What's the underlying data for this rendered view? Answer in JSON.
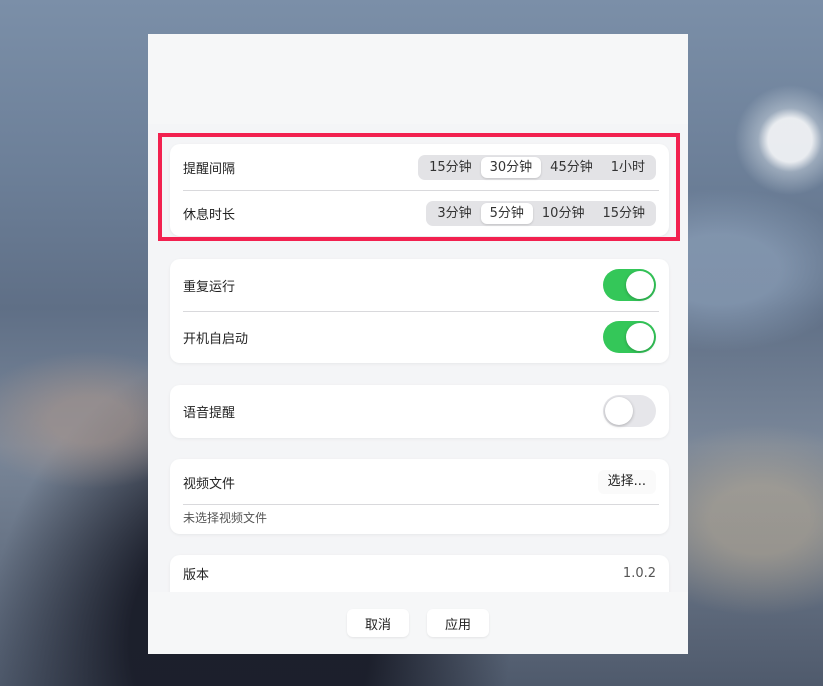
{
  "colors": {
    "accent": "#34c759",
    "highlight": "#f2214f"
  },
  "reminder": {
    "interval_label": "提醒间隔",
    "interval_options": [
      "15分钟",
      "30分钟",
      "45分钟",
      "1小时"
    ],
    "interval_selected": "30分钟",
    "rest_label": "休息时长",
    "rest_options": [
      "3分钟",
      "5分钟",
      "10分钟",
      "15分钟"
    ],
    "rest_selected": "5分钟"
  },
  "general": {
    "repeat_label": "重复运行",
    "repeat_on": true,
    "autostart_label": "开机自启动",
    "autostart_on": true
  },
  "voice": {
    "label": "语音提醒",
    "on": false
  },
  "video": {
    "label": "视频文件",
    "choose_label": "选择...",
    "status": "未选择视频文件"
  },
  "about": {
    "version_label": "版本",
    "version_value": "1.0.2"
  },
  "footer": {
    "cancel_label": "取消",
    "apply_label": "应用"
  }
}
